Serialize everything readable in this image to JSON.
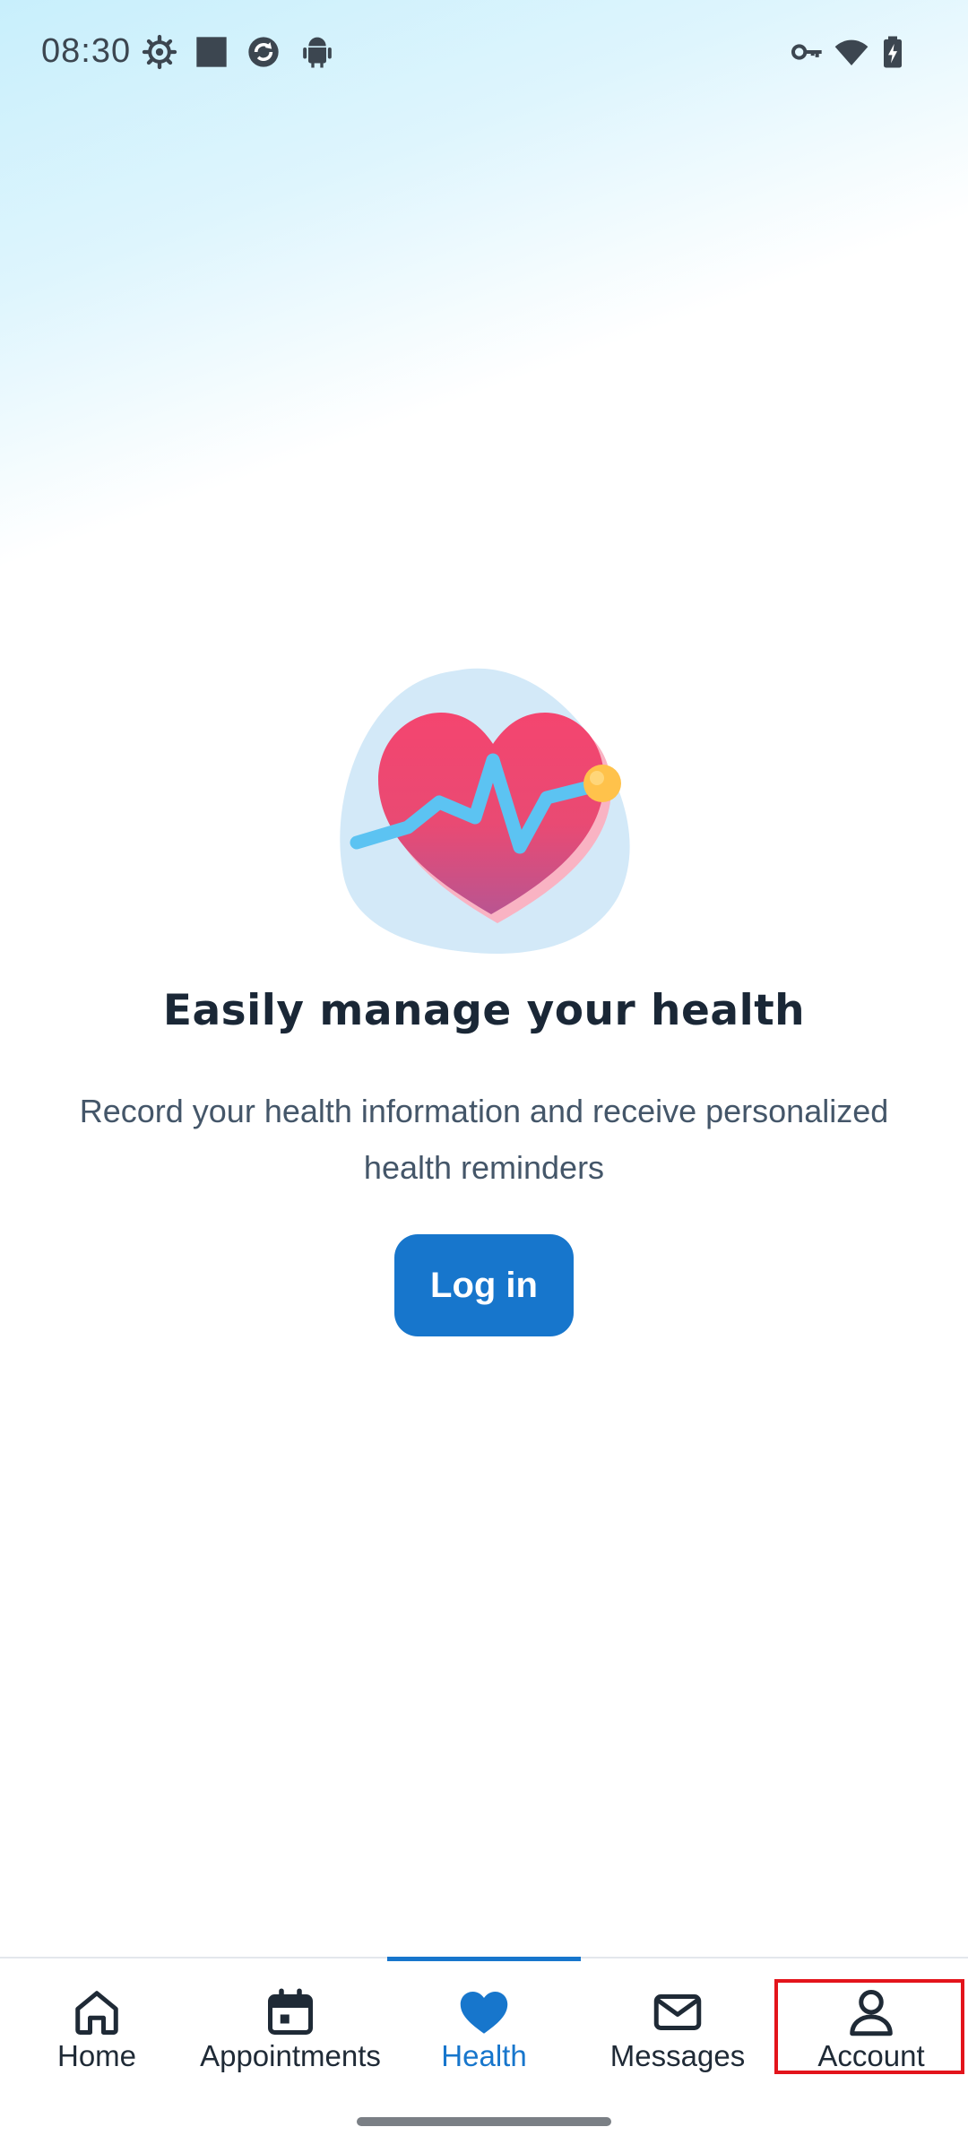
{
  "status_bar": {
    "time": "08:30",
    "left_icons": [
      "settings-gear-icon",
      "square-notification-icon",
      "sync-app-icon",
      "android-icon"
    ],
    "right_icons": [
      "vpn-key-icon",
      "wifi-icon",
      "battery-charging-icon"
    ]
  },
  "hero": {
    "illustration": "heart-pulse-icon"
  },
  "content": {
    "title": "Easily manage your health",
    "subtitle": "Record your health information and receive personalized health reminders",
    "login_label": "Log in"
  },
  "bottom_nav": {
    "items": [
      {
        "label": "Home",
        "icon": "home-icon"
      },
      {
        "label": "Appointments",
        "icon": "calendar-icon"
      },
      {
        "label": "Health",
        "icon": "heart-icon",
        "active": true
      },
      {
        "label": "Messages",
        "icon": "envelope-icon"
      },
      {
        "label": "Account",
        "icon": "person-icon",
        "highlighted": true
      }
    ]
  },
  "colors": {
    "accent": "#1776cc",
    "highlight": "#e3141b",
    "heart": "#f0476e",
    "pulse": "#5cc3f2",
    "dot": "#ffc24b"
  }
}
